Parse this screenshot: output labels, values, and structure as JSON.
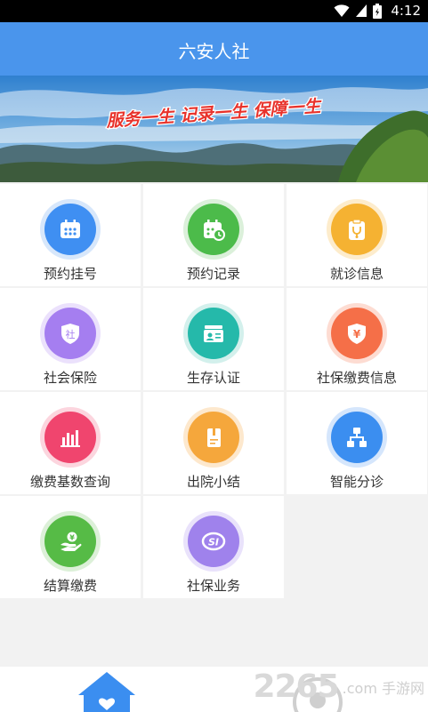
{
  "status": {
    "time": "4:12"
  },
  "app": {
    "title": "六安人社"
  },
  "banner": {
    "slogan": "服务一生 记录一生 保障一生"
  },
  "grid": {
    "items": [
      {
        "label": "预约挂号",
        "icon": "calendar-icon",
        "color": "#3f8ff2"
      },
      {
        "label": "预约记录",
        "icon": "calendar-clock-icon",
        "color": "#4cbb4a"
      },
      {
        "label": "就诊信息",
        "icon": "clipboard-stethoscope-icon",
        "color": "#f5b232"
      },
      {
        "label": "社会保险",
        "icon": "shield-she-icon",
        "color": "#a57ef0"
      },
      {
        "label": "生存认证",
        "icon": "id-card-icon",
        "color": "#25b9aa"
      },
      {
        "label": "社保缴费信息",
        "icon": "shield-yen-icon",
        "color": "#f56f48"
      },
      {
        "label": "缴费基数查询",
        "icon": "bar-chart-icon",
        "color": "#f0456e"
      },
      {
        "label": "出院小结",
        "icon": "document-icon",
        "color": "#f5a73c"
      },
      {
        "label": "智能分诊",
        "icon": "hierarchy-icon",
        "color": "#3b8ef0"
      },
      {
        "label": "结算缴费",
        "icon": "hand-coin-icon",
        "color": "#56bb46"
      },
      {
        "label": "社保业务",
        "icon": "si-logo-icon",
        "color": "#9f82ec"
      }
    ]
  },
  "watermark": {
    "number": "2265",
    "text": ".com 手游网"
  }
}
